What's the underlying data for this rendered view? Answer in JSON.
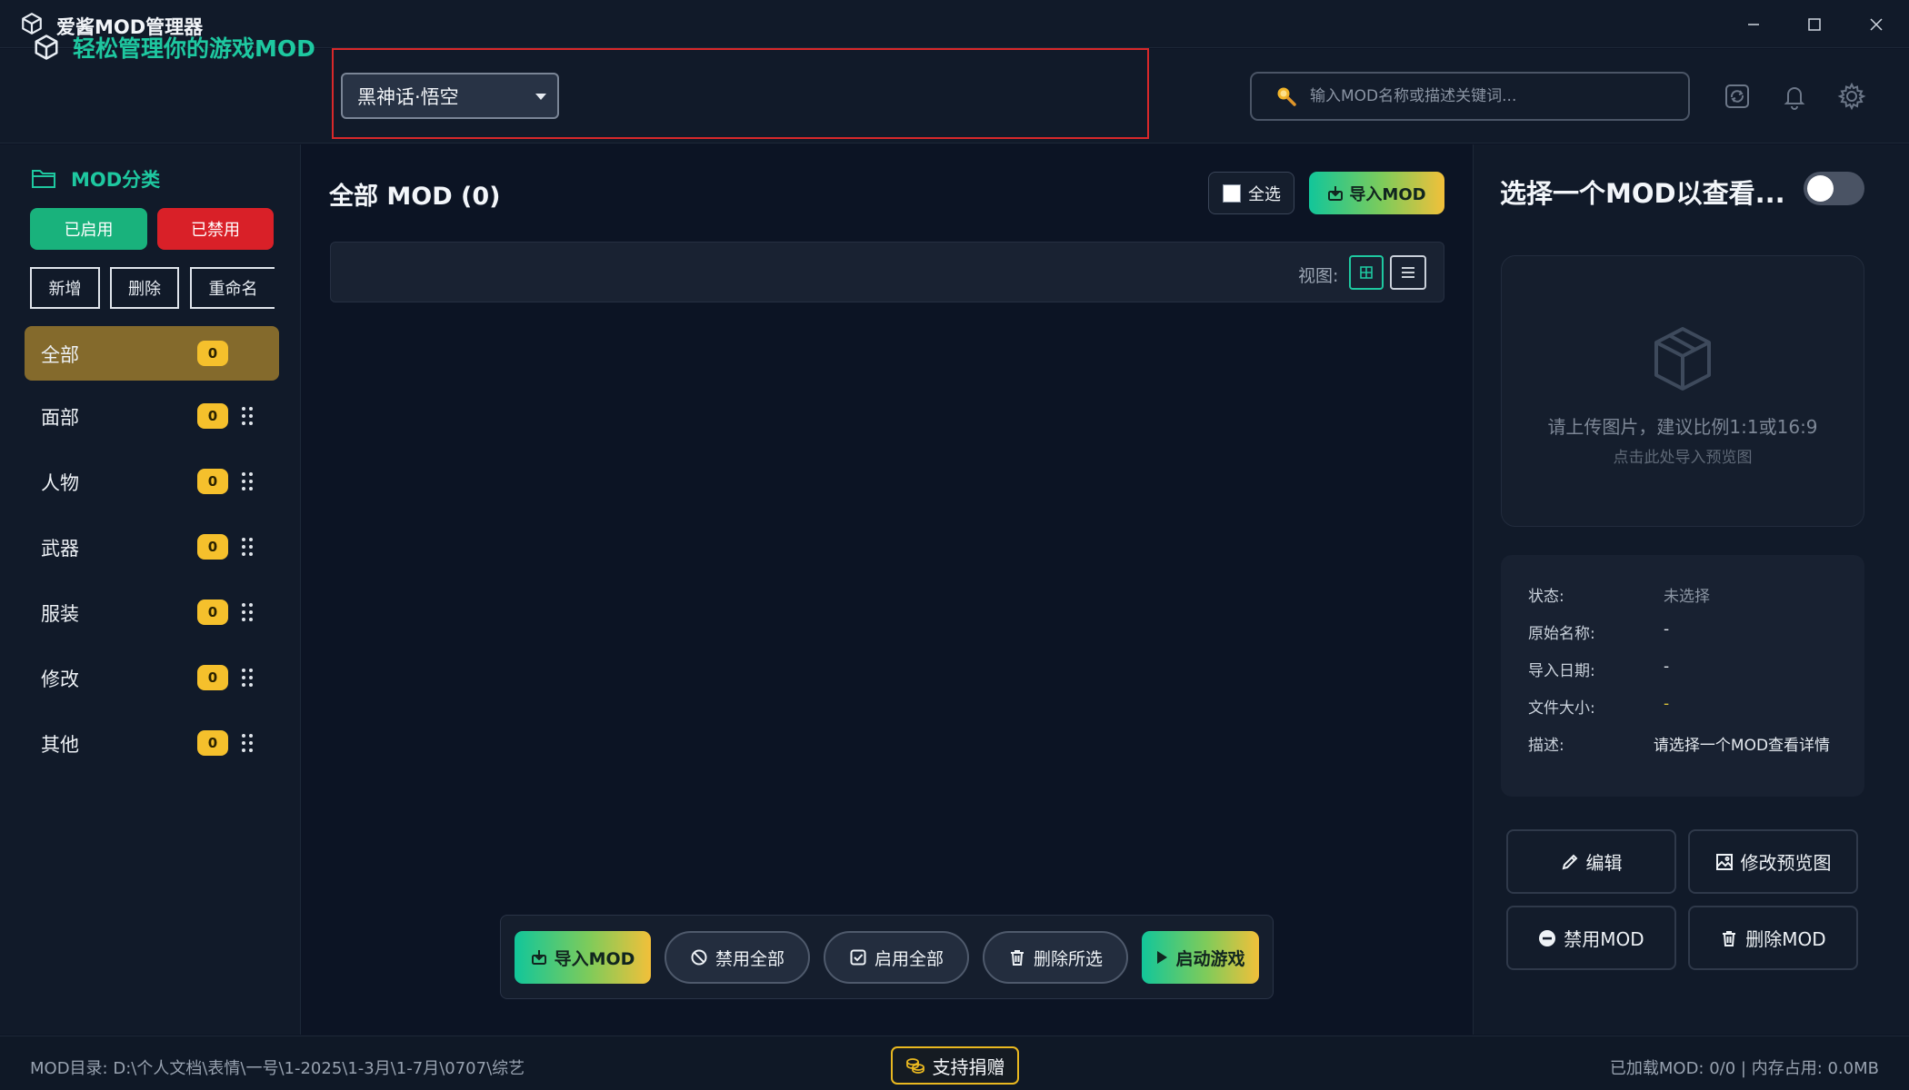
{
  "app": {
    "title": "爱酱MOD管理器"
  },
  "header": {
    "brand": "轻松管理你的游戏MOD",
    "game_select": "黑神话·悟空",
    "search_placeholder": "输入MOD名称或描述关键词..."
  },
  "sidebar": {
    "title": "MOD分类",
    "enabled_label": "已启用",
    "disabled_label": "已禁用",
    "new_label": "新增",
    "delete_label": "删除",
    "rename_label": "重命名",
    "categories": [
      {
        "label": "全部",
        "count": "0",
        "active": true
      },
      {
        "label": "面部",
        "count": "0"
      },
      {
        "label": "人物",
        "count": "0"
      },
      {
        "label": "武器",
        "count": "0"
      },
      {
        "label": "服装",
        "count": "0"
      },
      {
        "label": "修改",
        "count": "0"
      },
      {
        "label": "其他",
        "count": "0"
      }
    ]
  },
  "main": {
    "title": "全部 MOD (0)",
    "select_all": "全选",
    "import_label": "导入MOD",
    "view_label": "视图:",
    "toolbar": {
      "import": "导入MOD",
      "disable_all": "禁用全部",
      "enable_all": "启用全部",
      "delete_selected": "删除所选",
      "launch": "启动游戏"
    }
  },
  "detail": {
    "title": "选择一个MOD以查看...",
    "preview_main": "请上传图片，建议比例1:1或16:9",
    "preview_sub": "点击此处导入预览图",
    "info": {
      "status_label": "状态:",
      "status_value": "未选择",
      "orig_name_label": "原始名称:",
      "orig_name_value": "-",
      "import_date_label": "导入日期:",
      "import_date_value": "-",
      "size_label": "文件大小:",
      "size_value": "-",
      "desc_label": "描述:",
      "desc_value": "请选择一个MOD查看详情"
    },
    "actions": {
      "edit": "编辑",
      "edit_preview": "修改预览图",
      "disable_mod": "禁用MOD",
      "delete_mod": "删除MOD"
    }
  },
  "status": {
    "mod_dir": "MOD目录: D:\\个人文档\\表情\\一号\\1-2025\\1-3月\\1-7月\\0707\\综艺",
    "donate": "支持捐赠",
    "loaded": "已加载MOD: 0/0 | 内存占用: 0.0MB"
  },
  "colors": {
    "accent": "#1ec8a0",
    "badge": "#f5c02c",
    "danger": "#d92028",
    "active_category": "#846a2c"
  }
}
